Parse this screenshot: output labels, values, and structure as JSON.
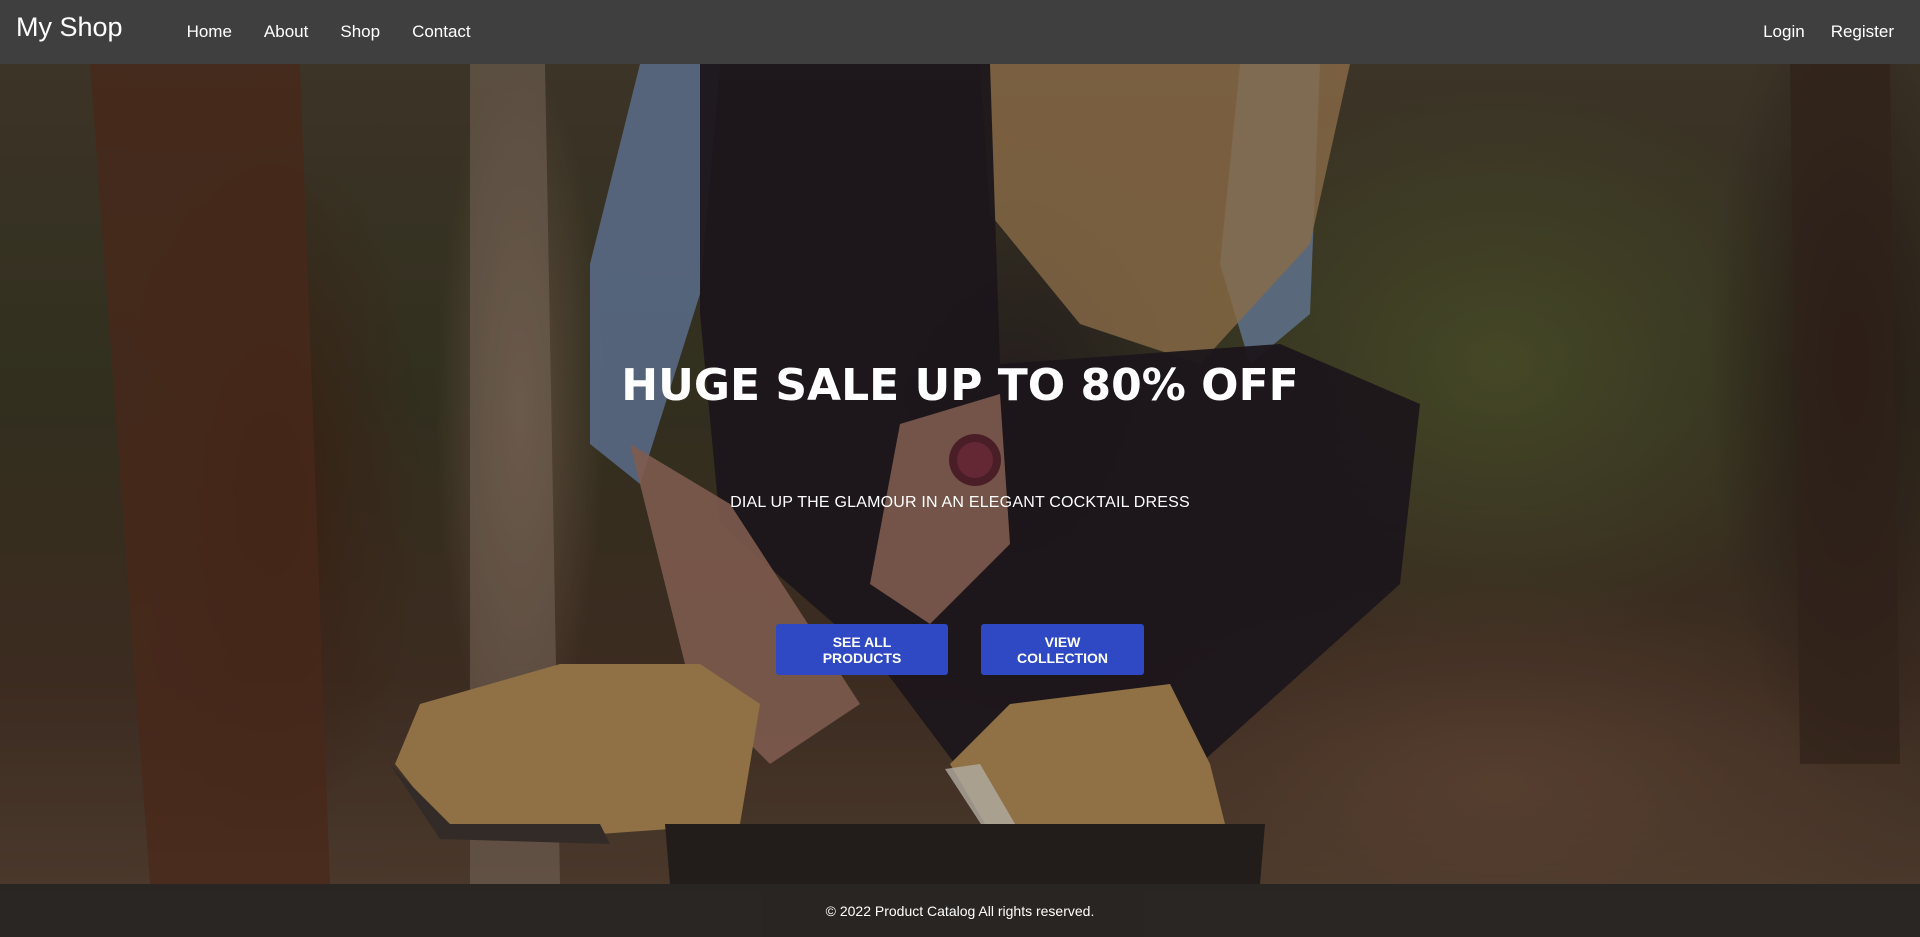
{
  "navbar": {
    "brand": "My Shop",
    "links": [
      "Home",
      "About",
      "Shop",
      "Contact"
    ],
    "right_links": [
      "Login",
      "Register"
    ],
    "background": "#3f3f3f"
  },
  "hero": {
    "title": "HUGE SALE UP TO 80% OFF",
    "subtitle": "DIAL UP THE GLAMOUR IN AN ELEGANT COCKTAIL DRESS",
    "buttons": {
      "products": "SEE ALL PRODUCTS",
      "collection": "VIEW COLLECTION"
    },
    "button_color": "#2f49c4",
    "image": "woman-tying-boots-forest-photo"
  },
  "footer": {
    "text": "© 2022 Product Catalog All rights reserved."
  }
}
